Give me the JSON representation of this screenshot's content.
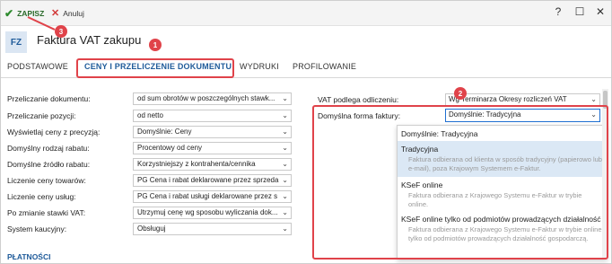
{
  "toolbar": {
    "save_label": "ZAPISZ",
    "cancel_label": "Anuluj",
    "help": "?",
    "minimize": "☐",
    "close": "✕"
  },
  "header": {
    "badge": "FZ",
    "title": "Faktura VAT zakupu"
  },
  "tabs": [
    {
      "label": "PODSTAWOWE"
    },
    {
      "label": "CENY I PRZELICZENIE DOKUMENTU"
    },
    {
      "label": "WYDRUKI"
    },
    {
      "label": "PROFILOWANIE"
    }
  ],
  "left_fields": [
    {
      "label": "Przeliczanie dokumentu:",
      "value": "od sum obrotów w poszczególnych stawk..."
    },
    {
      "label": "Przeliczanie pozycji:",
      "value": "od netto"
    },
    {
      "label": "Wyświetlaj ceny z precyzją:",
      "value": "Domyślnie: Ceny"
    },
    {
      "label": "Domyślny rodzaj rabatu:",
      "value": "Procentowy od ceny"
    },
    {
      "label": "Domyślne źródło rabatu:",
      "value": "Korzystniejszy z kontrahenta/cennika"
    },
    {
      "label": "Liczenie ceny towarów:",
      "value": "PG   Cena i rabat deklarowane przez sprzeda"
    },
    {
      "label": "Liczenie ceny usług:",
      "value": "PG   Cena i rabat usługi deklarowane przez s"
    },
    {
      "label": "Po zmianie stawki VAT:",
      "value": "Utrzymuj cenę wg sposobu wyliczania dok..."
    },
    {
      "label": "System kaucyjny:",
      "value": "Obsługuj"
    }
  ],
  "right_fields": [
    {
      "label": "VAT podlega odliczeniu:",
      "value": "Wg Terminarza Okresy rozliczeń VAT"
    },
    {
      "label": "Domyślna forma faktury:",
      "value": "Domyślnie: Tradycyjna"
    }
  ],
  "dropdown": {
    "items": [
      {
        "title": "Domyślnie: Tradycyjna",
        "desc": ""
      },
      {
        "title": "Tradycyjna",
        "desc": "Faktura odbierana od klienta w sposób tradycyjny (papierowo lub e-mail), poza Krajowym Systemem e-Faktur."
      },
      {
        "title": "KSeF online",
        "desc": "Faktura odbierana z Krajowego Systemu e-Faktur w trybie online."
      },
      {
        "title": "KSeF online tylko od podmiotów prowadzących działalność",
        "desc": "Faktura odbierana z Krajowego Systemu e-Faktur w trybie online tylko od podmiotów prowadzących działalność gospodarczą."
      }
    ]
  },
  "section": {
    "payments": "PŁATNOŚCI"
  },
  "annotations": {
    "step1": "1",
    "step2": "2",
    "step3": "3",
    "color": "#e0434a"
  }
}
